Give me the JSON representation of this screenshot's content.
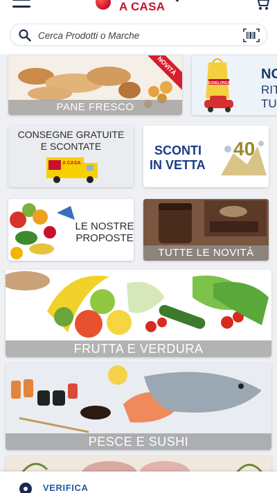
{
  "header": {
    "logo_text": "A CASA",
    "search_placeholder": "Cerca Prodotti o Marche"
  },
  "tiles": {
    "pane_fresco": {
      "caption": "PANE FRESCO",
      "badge": "NOVITÀ"
    },
    "promo_partial": {
      "line1": "NO",
      "line2": "RIT",
      "line3": "TU",
      "brand": "ESSELUNGA"
    },
    "consegne": {
      "line1": "CONSEGNE GRATUITE",
      "line2": "E SCONTATE",
      "truck_text": "A CASA"
    },
    "sconti": {
      "line1": "SCONTI",
      "line2": "IN VETTA",
      "number": "40"
    },
    "proposte": {
      "line1": "LE NOSTRE",
      "line2": "PROPOSTE"
    },
    "novita": {
      "caption": "TUTTE LE NOVITÀ"
    },
    "frutta": {
      "caption": "FRUTTA E VERDURA"
    },
    "pesce": {
      "caption": "PESCE E SUSHI"
    }
  },
  "bottom_bar": {
    "label": "VERIFICA"
  },
  "colors": {
    "brand_red": "#c8102e",
    "navy": "#1b2a4a",
    "link_blue": "#1e5aa8"
  }
}
